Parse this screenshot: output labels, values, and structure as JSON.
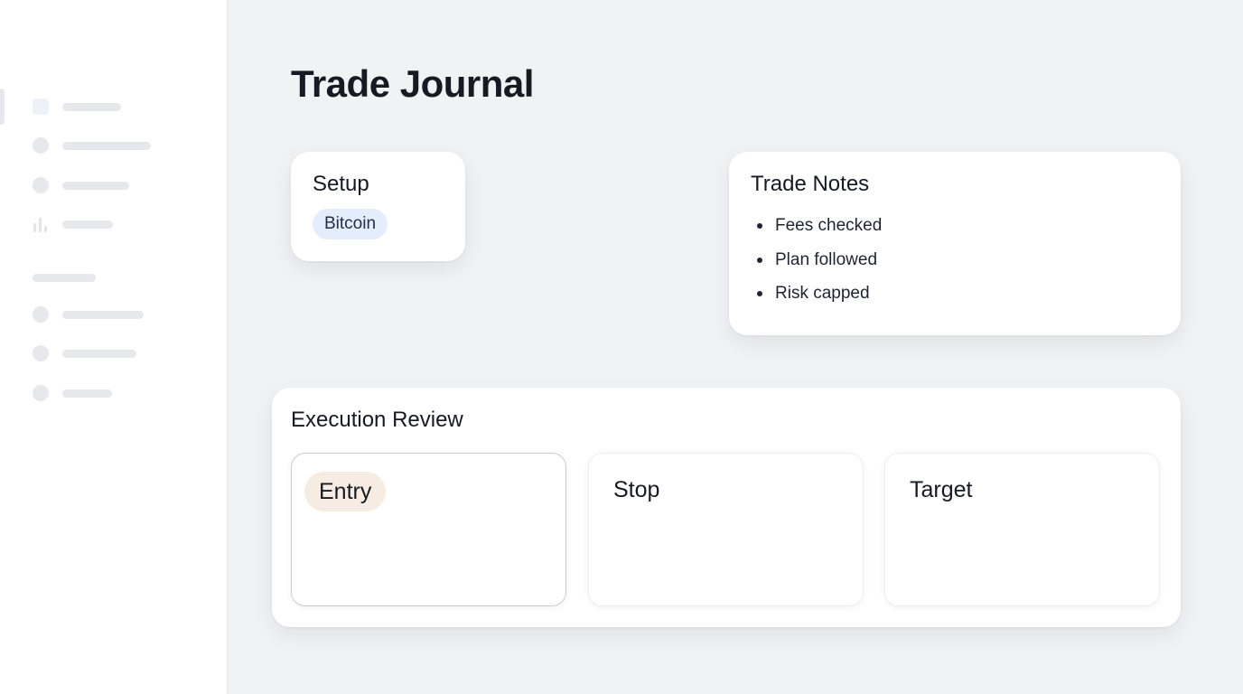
{
  "page": {
    "title": "Trade Journal"
  },
  "sidebar": {
    "items": [
      {
        "icon": "dashboard-square-icon"
      },
      {
        "icon": "circle-icon"
      },
      {
        "icon": "circle-icon"
      },
      {
        "icon": "bar-chart-icon"
      },
      {
        "icon": "circle-icon"
      },
      {
        "icon": "circle-icon"
      },
      {
        "icon": "circle-icon"
      }
    ]
  },
  "setup": {
    "title": "Setup",
    "tag": "Bitcoin"
  },
  "notes": {
    "title": "Trade Notes",
    "items": [
      "Fees checked",
      "Plan followed",
      "Risk capped"
    ]
  },
  "review": {
    "title": "Execution Review",
    "cards": [
      {
        "label": "Entry"
      },
      {
        "label": "Stop"
      },
      {
        "label": "Target"
      }
    ]
  },
  "colors": {
    "background": "#f1f2f4",
    "card": "#ffffff",
    "tag_bitcoin": "#e3edfb",
    "tag_entry": "#f6ece2",
    "text": "#161a22"
  }
}
